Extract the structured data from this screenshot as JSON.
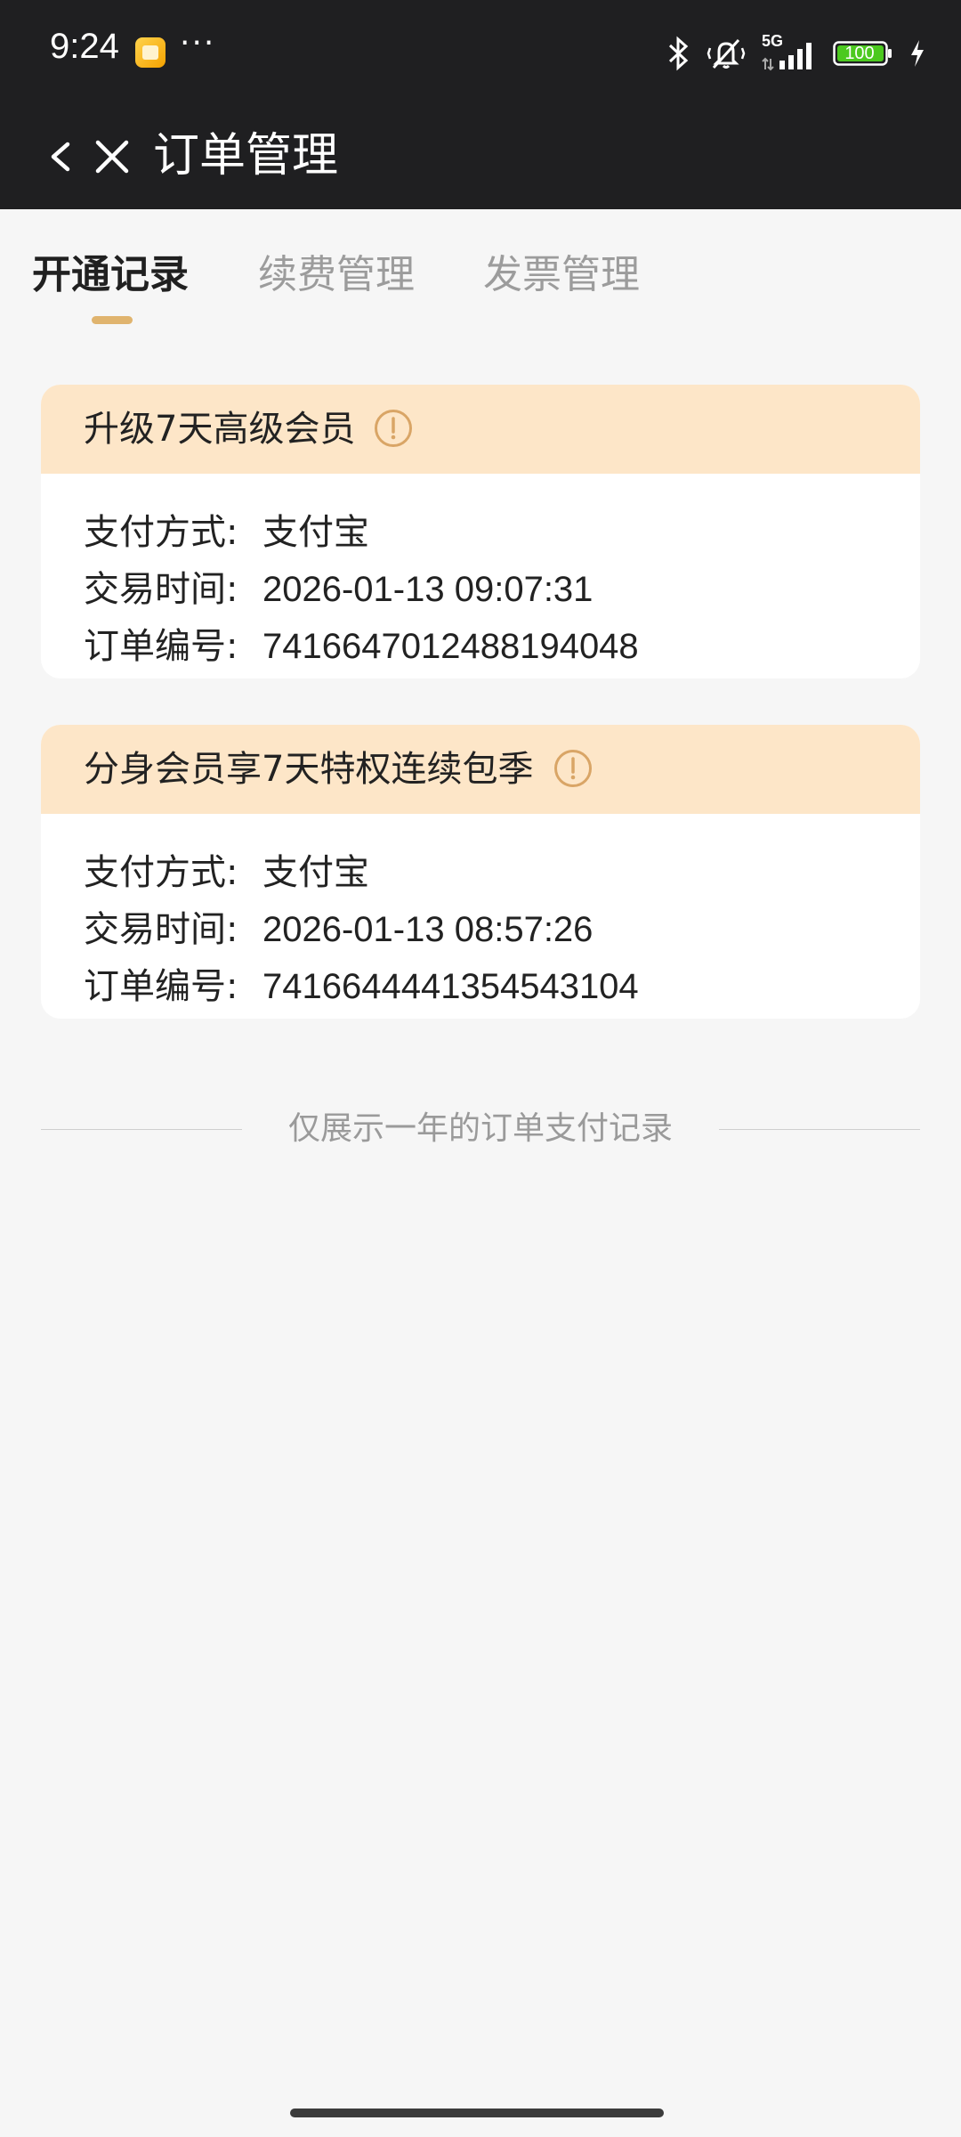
{
  "status_bar": {
    "time": "9:24",
    "battery_level": "100",
    "network": "5G",
    "icons": [
      "app-notification-icon",
      "more-dots-icon",
      "bluetooth-icon",
      "mute-vibrate-icon",
      "signal-icon",
      "battery-icon",
      "charging-icon"
    ]
  },
  "nav": {
    "title": "订单管理",
    "back_icon": "back-arrow-icon",
    "close_icon": "close-icon"
  },
  "tabs": [
    {
      "label": "开通记录",
      "active": true
    },
    {
      "label": "续费管理",
      "active": false
    },
    {
      "label": "发票管理",
      "active": false
    }
  ],
  "orders": [
    {
      "title": "升级7天高级会员",
      "pay_label": "支付方式:",
      "pay_value": "支付宝",
      "time_label": "交易时间:",
      "time_value": "2026-01-13 09:07:31",
      "id_label": "订单编号:",
      "id_value": "7416647012488194048"
    },
    {
      "title": "分身会员享7天特权连续包季",
      "pay_label": "支付方式:",
      "pay_value": "支付宝",
      "time_label": "交易时间:",
      "time_value": "2026-01-13 08:57:26",
      "id_label": "订单编号:",
      "id_value": "7416644441354543104"
    }
  ],
  "footer_note": "仅展示一年的订单支付记录",
  "colors": {
    "header_bg": "#1f1f21",
    "card_header_bg": "#fde6c8",
    "accent": "#e0b46e",
    "page_bg": "#f6f6f6"
  }
}
